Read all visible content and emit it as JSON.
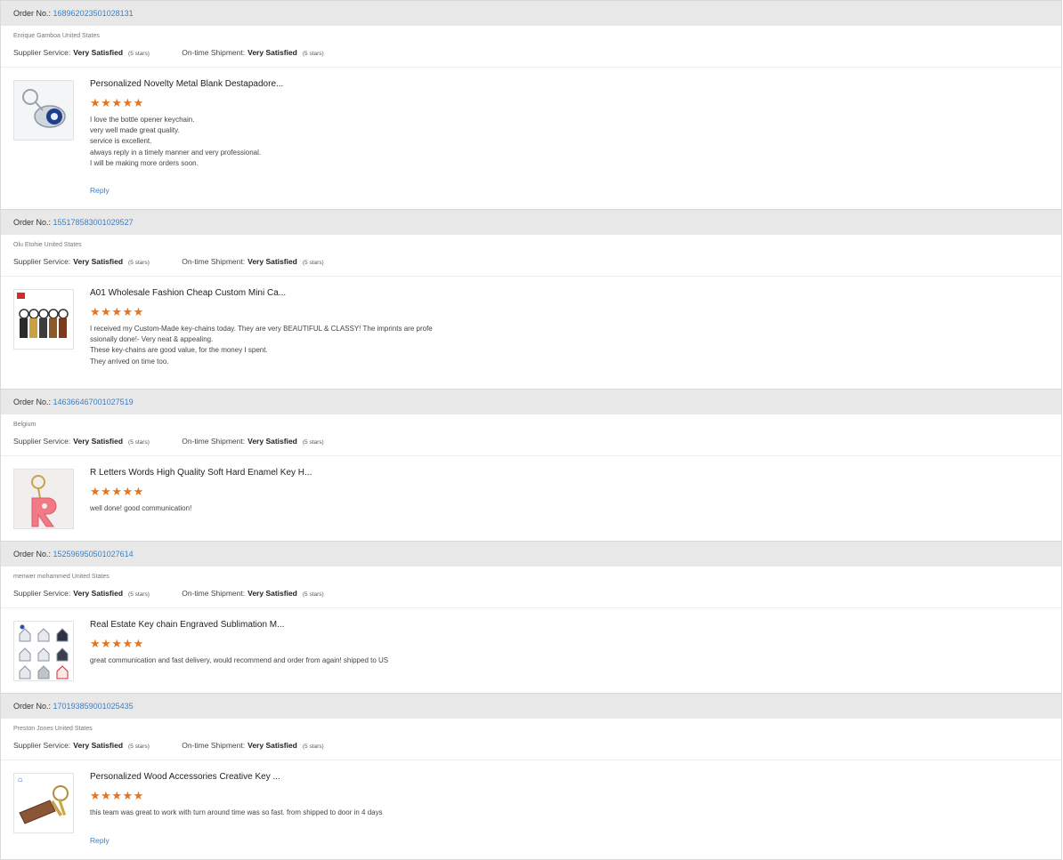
{
  "reviews": [
    {
      "order_label": "Order No.:",
      "order_number": "168962023501028131",
      "buyer": "Enrique Gamboa United States",
      "supplier_service_label": "Supplier Service:",
      "supplier_service_value": "Very Satisfied",
      "supplier_service_stars": "(5 stars)",
      "shipment_label": "On-time Shipment:",
      "shipment_value": "Very Satisfied",
      "shipment_stars": "(5 stars)",
      "product_title": "Personalized Novelty Metal Blank Destapadore...",
      "rating_stars": 5,
      "review_lines": [
        "I love the bottle opener keychain.",
        "very well made great quality.",
        "service is excellent.",
        "always reply in a timely manner and very professional.",
        "I will be making more orders soon."
      ],
      "reply_label": "Reply",
      "thumb_icon": "bottle-opener-keychain-icon"
    },
    {
      "order_label": "Order No.:",
      "order_number": "155178583001029527",
      "buyer": "Olu Etohie United States",
      "supplier_service_label": "Supplier Service:",
      "supplier_service_value": "Very Satisfied",
      "supplier_service_stars": "(5 stars)",
      "shipment_label": "On-time Shipment:",
      "shipment_value": "Very Satisfied",
      "shipment_stars": "(5 stars)",
      "product_title": "A01 Wholesale Fashion Cheap Custom Mini Ca...",
      "rating_stars": 5,
      "review_lines": [
        "I received my Custom-Made key-chains today.  They are very BEAUTIFUL & CLASSY!   The imprints are profe",
        "ssionally done!- Very neat & appealing.",
        "These key-chains are good value, for the money I spent.",
        "They arrived on time too."
      ],
      "reply_label": "",
      "thumb_icon": "leather-keychains-icon"
    },
    {
      "order_label": "Order No.:",
      "order_number": "146366467001027519",
      "buyer": "Belgium",
      "supplier_service_label": "Supplier Service:",
      "supplier_service_value": "Very Satisfied",
      "supplier_service_stars": "(5 stars)",
      "shipment_label": "On-time Shipment:",
      "shipment_value": "Very Satisfied",
      "shipment_stars": "(5 stars)",
      "product_title": "R Letters Words High Quality Soft Hard Enamel Key H...",
      "rating_stars": 5,
      "review_lines": [
        "well done! good communication!"
      ],
      "reply_label": "",
      "thumb_icon": "letter-r-keychain-icon"
    },
    {
      "order_label": "Order No.:",
      "order_number": "152596950501027614",
      "buyer": "menwer mohammed United States",
      "supplier_service_label": "Supplier Service:",
      "supplier_service_value": "Very Satisfied",
      "supplier_service_stars": "(5 stars)",
      "shipment_label": "On-time Shipment:",
      "shipment_value": "Very Satisfied",
      "shipment_stars": "(5 stars)",
      "product_title": "Real Estate Key chain Engraved Sublimation M...",
      "rating_stars": 5,
      "review_lines": [
        "great communication and fast delivery, would recommend and order from again! shipped to US"
      ],
      "reply_label": "",
      "thumb_icon": "house-keychains-icon"
    },
    {
      "order_label": "Order No.:",
      "order_number": "170193859001025435",
      "buyer": "Preston Jones United States",
      "supplier_service_label": "Supplier Service:",
      "supplier_service_value": "Very Satisfied",
      "supplier_service_stars": "(5 stars)",
      "shipment_label": "On-time Shipment:",
      "shipment_value": "Very Satisfied",
      "shipment_stars": "(5 stars)",
      "product_title": "Personalized Wood Accessories Creative Key ...",
      "rating_stars": 5,
      "review_lines": [
        "this team was great to work with turn around time was so fast. from shipped to door in 4 days"
      ],
      "reply_label": "Reply",
      "thumb_icon": "wood-keychain-icon"
    }
  ],
  "colors": {
    "link": "#3a7fc6",
    "star": "#e8731d",
    "header_bg": "#e8e8e8"
  }
}
